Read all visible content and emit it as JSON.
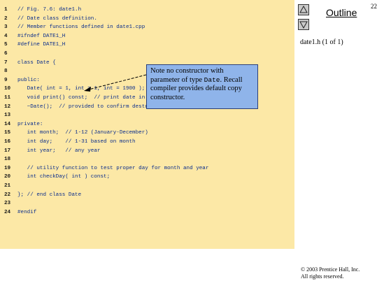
{
  "slide": {
    "page_number": "22",
    "outline_label": "Outline",
    "file_label": "date1.h  (1 of 1)",
    "nav_up_icon": "triangle-up-icon",
    "nav_down_icon": "triangle-down-icon",
    "copyright_line1": "© 2003 Prentice Hall, Inc.",
    "copyright_line2": "All rights reserved."
  },
  "code": {
    "lines": [
      {
        "num": "1",
        "text": "// Fig. 7.6: date1.h"
      },
      {
        "num": "2",
        "text": "// Date class definition."
      },
      {
        "num": "3",
        "text": "// Member functions defined in date1.cpp"
      },
      {
        "num": "4",
        "text": "#ifndef DATE1_H"
      },
      {
        "num": "5",
        "text": "#define DATE1_H"
      },
      {
        "num": "6",
        "text": ""
      },
      {
        "num": "7",
        "text": "class Date {"
      },
      {
        "num": "8",
        "text": ""
      },
      {
        "num": "9",
        "text": "public:"
      },
      {
        "num": "10",
        "text": "   Date( int = 1, int = 1, int = 1900 ); // default constructor"
      },
      {
        "num": "11",
        "text": "   void print() const;  // print date in month/day/year format"
      },
      {
        "num": "12",
        "text": "   ~Date();  // provided to confirm destruction order"
      },
      {
        "num": "13",
        "text": ""
      },
      {
        "num": "14",
        "text": "private:"
      },
      {
        "num": "15",
        "text": "   int month;  // 1-12 (January-December)"
      },
      {
        "num": "16",
        "text": "   int day;    // 1-31 based on month"
      },
      {
        "num": "17",
        "text": "   int year;   // any year"
      },
      {
        "num": "18",
        "text": ""
      },
      {
        "num": "19",
        "text": "   // utility function to test proper day for month and year"
      },
      {
        "num": "20",
        "text": "   int checkDay( int ) const;"
      },
      {
        "num": "21",
        "text": ""
      },
      {
        "num": "22",
        "text": "}; // end class Date"
      },
      {
        "num": "23",
        "text": ""
      },
      {
        "num": "24",
        "text": "#endif"
      }
    ]
  },
  "note": {
    "part1": "Note no constructor with parameter of type ",
    "part2": "Date",
    "part3": ". Recall compiler provides default copy constructor."
  }
}
